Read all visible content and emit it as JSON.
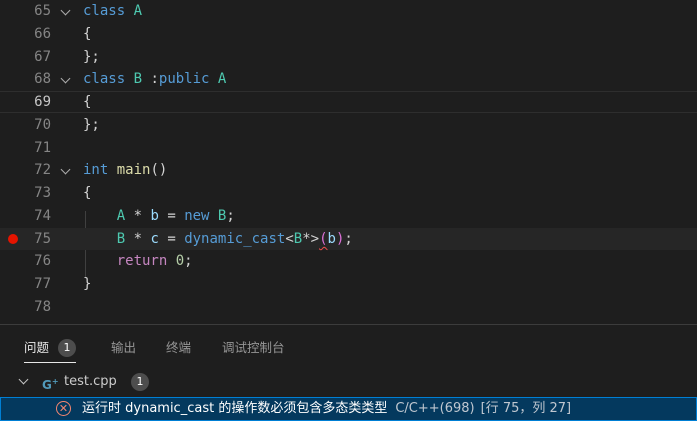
{
  "editor": {
    "lines": [
      {
        "num": "65",
        "tokens": [
          {
            "t": "class",
            "c": "kw"
          },
          {
            "t": " "
          },
          {
            "t": "A",
            "c": "type"
          }
        ],
        "fold": true
      },
      {
        "num": "66",
        "tokens": [
          {
            "t": "{"
          }
        ]
      },
      {
        "num": "67",
        "tokens": [
          {
            "t": "};"
          }
        ]
      },
      {
        "num": "68",
        "tokens": [
          {
            "t": "class",
            "c": "kw"
          },
          {
            "t": " "
          },
          {
            "t": "B",
            "c": "type"
          },
          {
            "t": " :",
            "c": "punc"
          },
          {
            "t": "public",
            "c": "kw"
          },
          {
            "t": " "
          },
          {
            "t": "A",
            "c": "type"
          }
        ],
        "fold": true
      },
      {
        "num": "69",
        "tokens": [
          {
            "t": "{"
          }
        ],
        "current": true
      },
      {
        "num": "70",
        "tokens": [
          {
            "t": "};"
          }
        ]
      },
      {
        "num": "71",
        "tokens": []
      },
      {
        "num": "72",
        "tokens": [
          {
            "t": "int",
            "c": "kw"
          },
          {
            "t": " "
          },
          {
            "t": "main",
            "c": "fn"
          },
          {
            "t": "()"
          }
        ],
        "fold": true
      },
      {
        "num": "73",
        "tokens": [
          {
            "t": "{"
          }
        ]
      },
      {
        "num": "74",
        "tokens": [
          {
            "t": "    "
          },
          {
            "t": "A",
            "c": "type"
          },
          {
            "t": " * "
          },
          {
            "t": "b",
            "c": "var"
          },
          {
            "t": " = "
          },
          {
            "t": "new",
            "c": "kw"
          },
          {
            "t": " "
          },
          {
            "t": "B",
            "c": "type"
          },
          {
            "t": ";"
          }
        ]
      },
      {
        "num": "75",
        "tokens": [
          {
            "t": "    "
          },
          {
            "t": "B",
            "c": "type"
          },
          {
            "t": " * "
          },
          {
            "t": "c",
            "c": "var"
          },
          {
            "t": " = "
          },
          {
            "t": "dynamic_cast",
            "c": "kw"
          },
          {
            "t": "<"
          },
          {
            "t": "B",
            "c": "type"
          },
          {
            "t": "*>"
          },
          {
            "t": "(",
            "c": "paren squiggle"
          },
          {
            "t": "b",
            "c": "var"
          },
          {
            "t": ")",
            "c": "paren"
          },
          {
            "t": ";"
          }
        ],
        "breakpoint": true,
        "cursorLine": true
      },
      {
        "num": "76",
        "tokens": [
          {
            "t": "    "
          },
          {
            "t": "return",
            "c": "ctl"
          },
          {
            "t": " "
          },
          {
            "t": "0",
            "c": "num"
          },
          {
            "t": ";"
          }
        ]
      },
      {
        "num": "77",
        "tokens": [
          {
            "t": "}"
          }
        ]
      },
      {
        "num": "78",
        "tokens": []
      }
    ]
  },
  "panel": {
    "tabs": [
      {
        "label": "问题",
        "badge": "1",
        "active": true
      },
      {
        "label": "输出"
      },
      {
        "label": "终端"
      },
      {
        "label": "调试控制台"
      }
    ],
    "file": {
      "icon_text": "G",
      "icon_sup": "+",
      "name": "test.cpp",
      "count": "1"
    },
    "problem": {
      "message": "运行时 dynamic_cast 的操作数必须包含多态类类型",
      "source": "C/C++(698)",
      "location": "[行 75，列 27]"
    }
  },
  "colors": {
    "background": "#1e1e1e",
    "keyword": "#569cd6",
    "type": "#4ec9b0",
    "function": "#dcdcaa",
    "control": "#c586c0",
    "number": "#b5cea8",
    "breakpoint": "#e51400",
    "selection_row": "#04395e",
    "selection_border": "#007fd4",
    "error_icon": "#f48771"
  }
}
